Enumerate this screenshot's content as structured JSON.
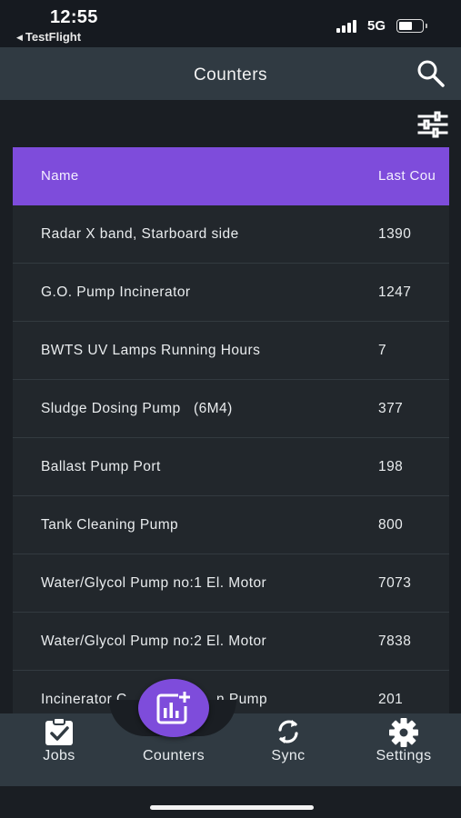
{
  "status_bar": {
    "time": "12:55",
    "back_app": "TestFlight",
    "network": "5G"
  },
  "header": {
    "title": "Counters"
  },
  "table": {
    "columns": [
      "Name",
      "Last Cou"
    ],
    "rows": [
      {
        "name": "Radar X band, Starboard side",
        "value": "1390"
      },
      {
        "name": "G.O. Pump Incinerator",
        "value": "1247"
      },
      {
        "name": "BWTS UV Lamps Running Hours",
        "value": "7"
      },
      {
        "name": "Sludge Dosing Pump   (6M4)",
        "value": "377"
      },
      {
        "name": "Ballast Pump Port",
        "value": "198"
      },
      {
        "name": "Tank Cleaning Pump",
        "value": "800"
      },
      {
        "name": "Water/Glycol Pump no:1 El. Motor",
        "value": "7073"
      },
      {
        "name": "Water/Glycol Pump no:2 El. Motor",
        "value": "7838"
      },
      {
        "name": "Incinerator C",
        "value": "201",
        "name_tail": "n Pump"
      }
    ]
  },
  "bottom_nav": {
    "items": [
      {
        "label": "Jobs",
        "icon": "clipboard-check-icon"
      },
      {
        "label": "Counters",
        "icon": "chart-add-icon"
      },
      {
        "label": "Sync",
        "icon": "sync-icon"
      },
      {
        "label": "Settings",
        "icon": "gear-icon"
      }
    ]
  },
  "colors": {
    "accent": "#7e4cdb",
    "app_bar": "#303a42",
    "background": "#1a1e23",
    "row": "#22272c"
  }
}
